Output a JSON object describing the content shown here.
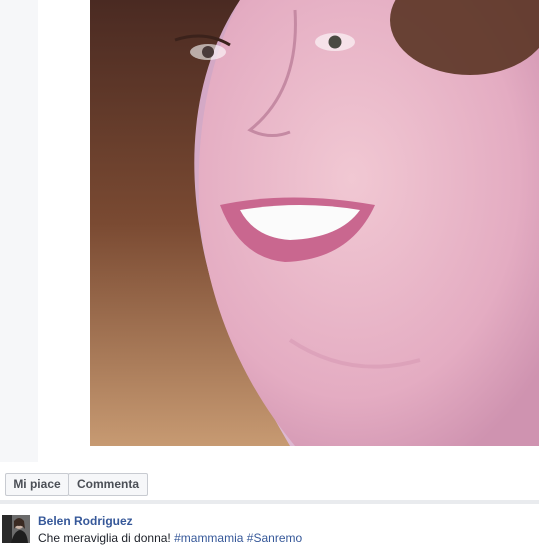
{
  "post_photo": {
    "alt": ""
  },
  "actions": {
    "like_label": "Mi piace",
    "comment_label": "Commenta"
  },
  "post": {
    "author": "Belen Rodriguez",
    "text": "Che meraviglia di donna!",
    "hashtags": [
      "#mammamia",
      "#Sanremo"
    ]
  },
  "colors": {
    "link": "#365899",
    "gutter": "#f6f7f9",
    "button_bg": "#f6f7f9"
  }
}
